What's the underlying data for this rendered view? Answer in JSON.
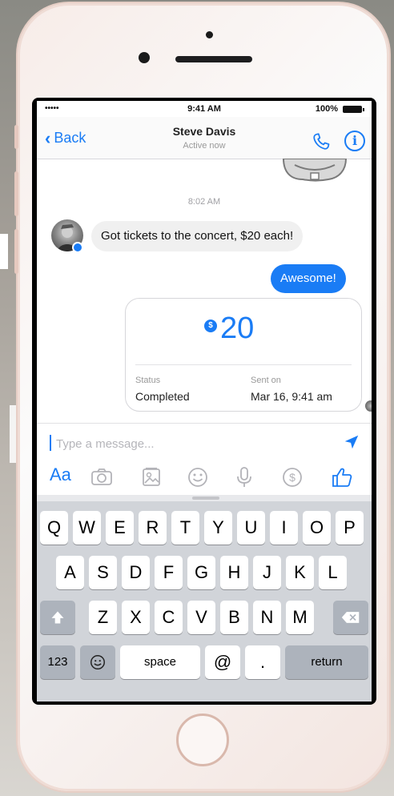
{
  "status_bar": {
    "signal": "•••••",
    "time": "9:41 AM",
    "battery": "100%"
  },
  "nav": {
    "back_label": "Back",
    "title": "Steve Davis",
    "subtitle": "Active now"
  },
  "conversation": {
    "timestamp": "8:02 AM",
    "incoming_message": "Got tickets to the concert, $20 each!",
    "outgoing_message": "Awesome!",
    "payment": {
      "currency_symbol": "$",
      "amount": "20",
      "status_label": "Status",
      "status_value": "Completed",
      "sent_label": "Sent on",
      "sent_value": "Mar 16, 9:41 am"
    }
  },
  "composer": {
    "placeholder": "Type a message..."
  },
  "toolbar": {
    "aa_label": "Aa",
    "icons": [
      "camera-icon",
      "gallery-icon",
      "emoji-icon",
      "microphone-icon",
      "payment-icon",
      "thumbs-up-icon"
    ]
  },
  "keyboard": {
    "row1": [
      "Q",
      "W",
      "E",
      "R",
      "T",
      "Y",
      "U",
      "I",
      "O",
      "P"
    ],
    "row2": [
      "A",
      "S",
      "D",
      "F",
      "G",
      "H",
      "J",
      "K",
      "L"
    ],
    "row3": [
      "Z",
      "X",
      "C",
      "V",
      "B",
      "N",
      "M"
    ],
    "numbers_label": "123",
    "space_label": "space",
    "at_label": "@",
    "dot_label": ".",
    "return_label": "return"
  },
  "colors": {
    "accent": "#1a7cf5",
    "incoming_bubble": "#f0f0f0",
    "keyboard_bg": "#d1d4d9"
  }
}
